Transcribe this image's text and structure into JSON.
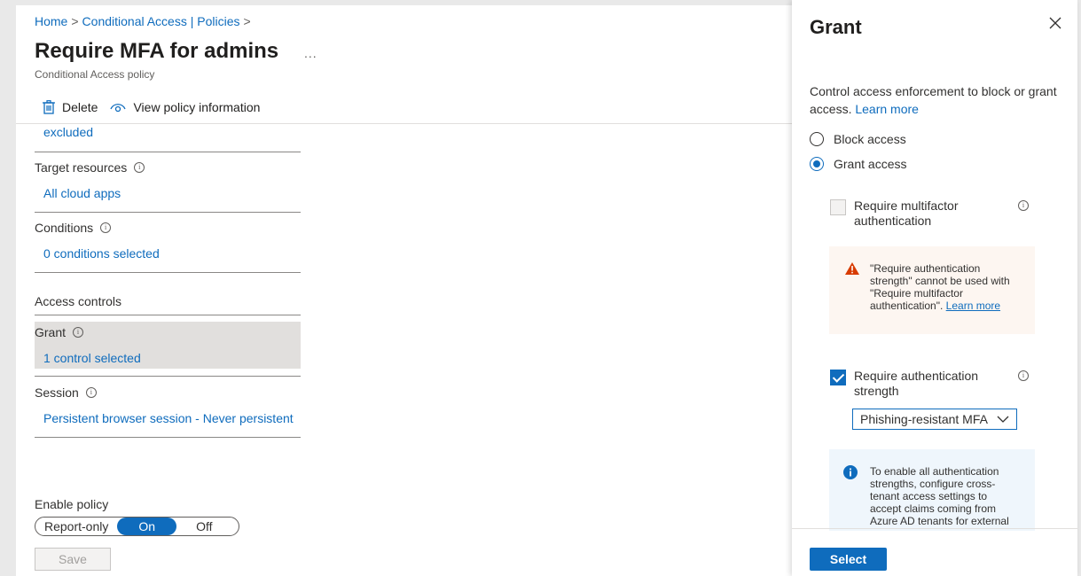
{
  "breadcrumb": {
    "home": "Home",
    "sep": ">",
    "policies": "Conditional Access | Policies"
  },
  "page": {
    "title": "Require MFA for admins",
    "more": "...",
    "subtitle": "Conditional Access policy"
  },
  "commands": {
    "delete": "Delete",
    "view_info": "View policy information"
  },
  "assignments": {
    "users_excluded": "excluded",
    "target_resources_label": "Target resources",
    "target_resources_value": "All cloud apps",
    "conditions_label": "Conditions",
    "conditions_value": "0 conditions selected"
  },
  "access_controls": {
    "heading": "Access controls",
    "grant_label": "Grant",
    "grant_value": "1 control selected",
    "session_label": "Session",
    "session_value": "Persistent browser session - Never persistent"
  },
  "enable_policy": {
    "label": "Enable policy",
    "options": [
      "Report-only",
      "On",
      "Off"
    ],
    "selected": "On"
  },
  "save_label": "Save",
  "panel": {
    "title": "Grant",
    "description": "Control access enforcement to block or grant access.",
    "learn_more": "Learn more",
    "block_access": "Block access",
    "grant_access": "Grant access",
    "require_mfa": "Require multifactor authentication",
    "warning_text": "\"Require authentication strength\" cannot be used with \"Require multifactor authentication\".",
    "warning_link": "Learn more",
    "require_auth_strength": "Require authentication strength",
    "auth_strength_value": "Phishing-resistant MFA",
    "info_text": "To enable all authentication strengths, configure cross-tenant access settings to accept claims coming from Azure AD tenants for external",
    "select_label": "Select"
  },
  "colors": {
    "accent": "#0f6cbd",
    "warning": "#d83b01"
  }
}
